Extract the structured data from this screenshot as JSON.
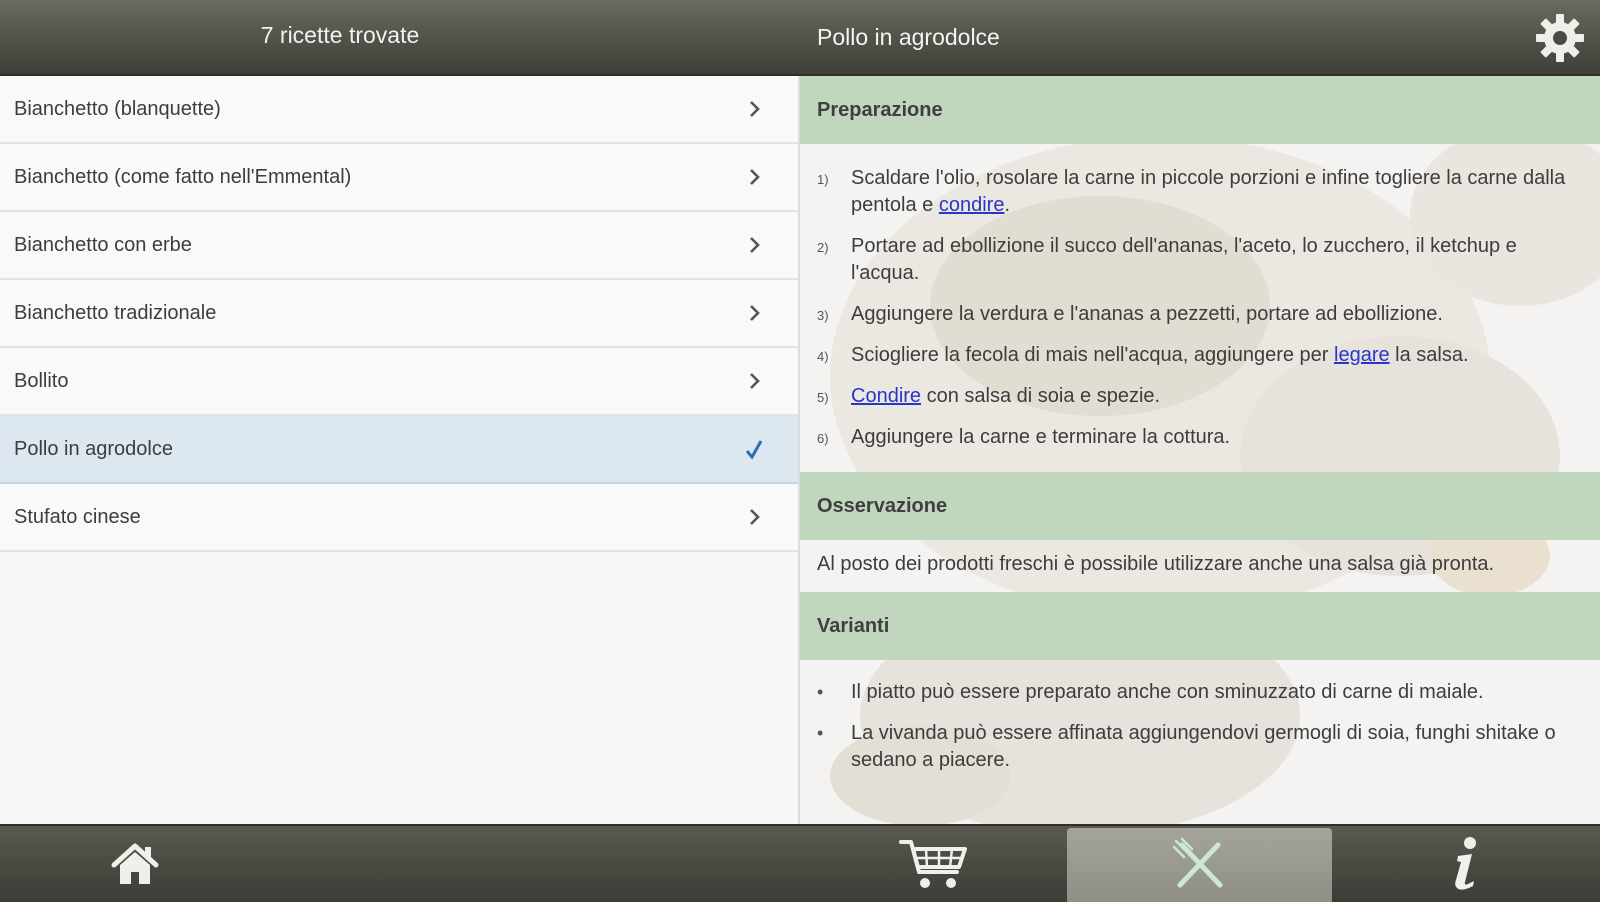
{
  "header": {
    "list_title": "7 ricette trovate",
    "detail_title": "Pollo in agrodolce",
    "settings_icon": "gear-icon"
  },
  "recipes": [
    {
      "label": "Bianchetto (blanquette)",
      "selected": false
    },
    {
      "label": "Bianchetto (come fatto nell'Emmental)",
      "selected": false
    },
    {
      "label": "Bianchetto con erbe",
      "selected": false
    },
    {
      "label": "Bianchetto tradizionale",
      "selected": false
    },
    {
      "label": "Bollito",
      "selected": false
    },
    {
      "label": "Pollo in agrodolce",
      "selected": true
    },
    {
      "label": "Stufato cinese",
      "selected": false
    }
  ],
  "detail": {
    "preparation": {
      "title": "Preparazione",
      "steps": [
        {
          "num": "1)",
          "before": "Scaldare l'olio, rosolare la carne in piccole porzioni e infine togliere la carne dalla pentola e ",
          "link": "condire",
          "after": "."
        },
        {
          "num": "2)",
          "before": "Portare ad ebollizione il succo dell'ananas, l'aceto, lo zucchero, il ketchup e l'acqua.",
          "link": "",
          "after": ""
        },
        {
          "num": "3)",
          "before": "Aggiungere la verdura e l'ananas a pezzetti, portare ad ebollizione.",
          "link": "",
          "after": ""
        },
        {
          "num": "4)",
          "before": "Sciogliere la fecola di mais nell'acqua, aggiungere per ",
          "link": "legare",
          "after": " la salsa."
        },
        {
          "num": "5)",
          "before": "",
          "link": "Condire",
          "after": " con salsa di soia e spezie."
        },
        {
          "num": "6)",
          "before": "Aggiungere la carne e terminare la cottura.",
          "link": "",
          "after": ""
        }
      ]
    },
    "observation": {
      "title": "Osservazione",
      "text": "Al posto dei prodotti freschi è possibile utilizzare anche una salsa già pronta."
    },
    "variants": {
      "title": "Varianti",
      "items": [
        "Il piatto può essere preparato anche con sminuzzato di carne di maiale.",
        "La vivanda può essere affinata aggiungendovi germogli di soia, funghi shitake o sedano a piacere."
      ]
    }
  },
  "bottom_nav": [
    {
      "icon": "home-icon",
      "active": false
    },
    {
      "icon": "cart-icon",
      "active": false
    },
    {
      "icon": "fork-knife-icon",
      "active": true
    },
    {
      "icon": "info-icon",
      "active": false
    }
  ],
  "colors": {
    "section_header": "#c0d6bd",
    "selected_row": "#dde7f0",
    "link": "#2a36c8",
    "check": "#2a6fb8"
  }
}
